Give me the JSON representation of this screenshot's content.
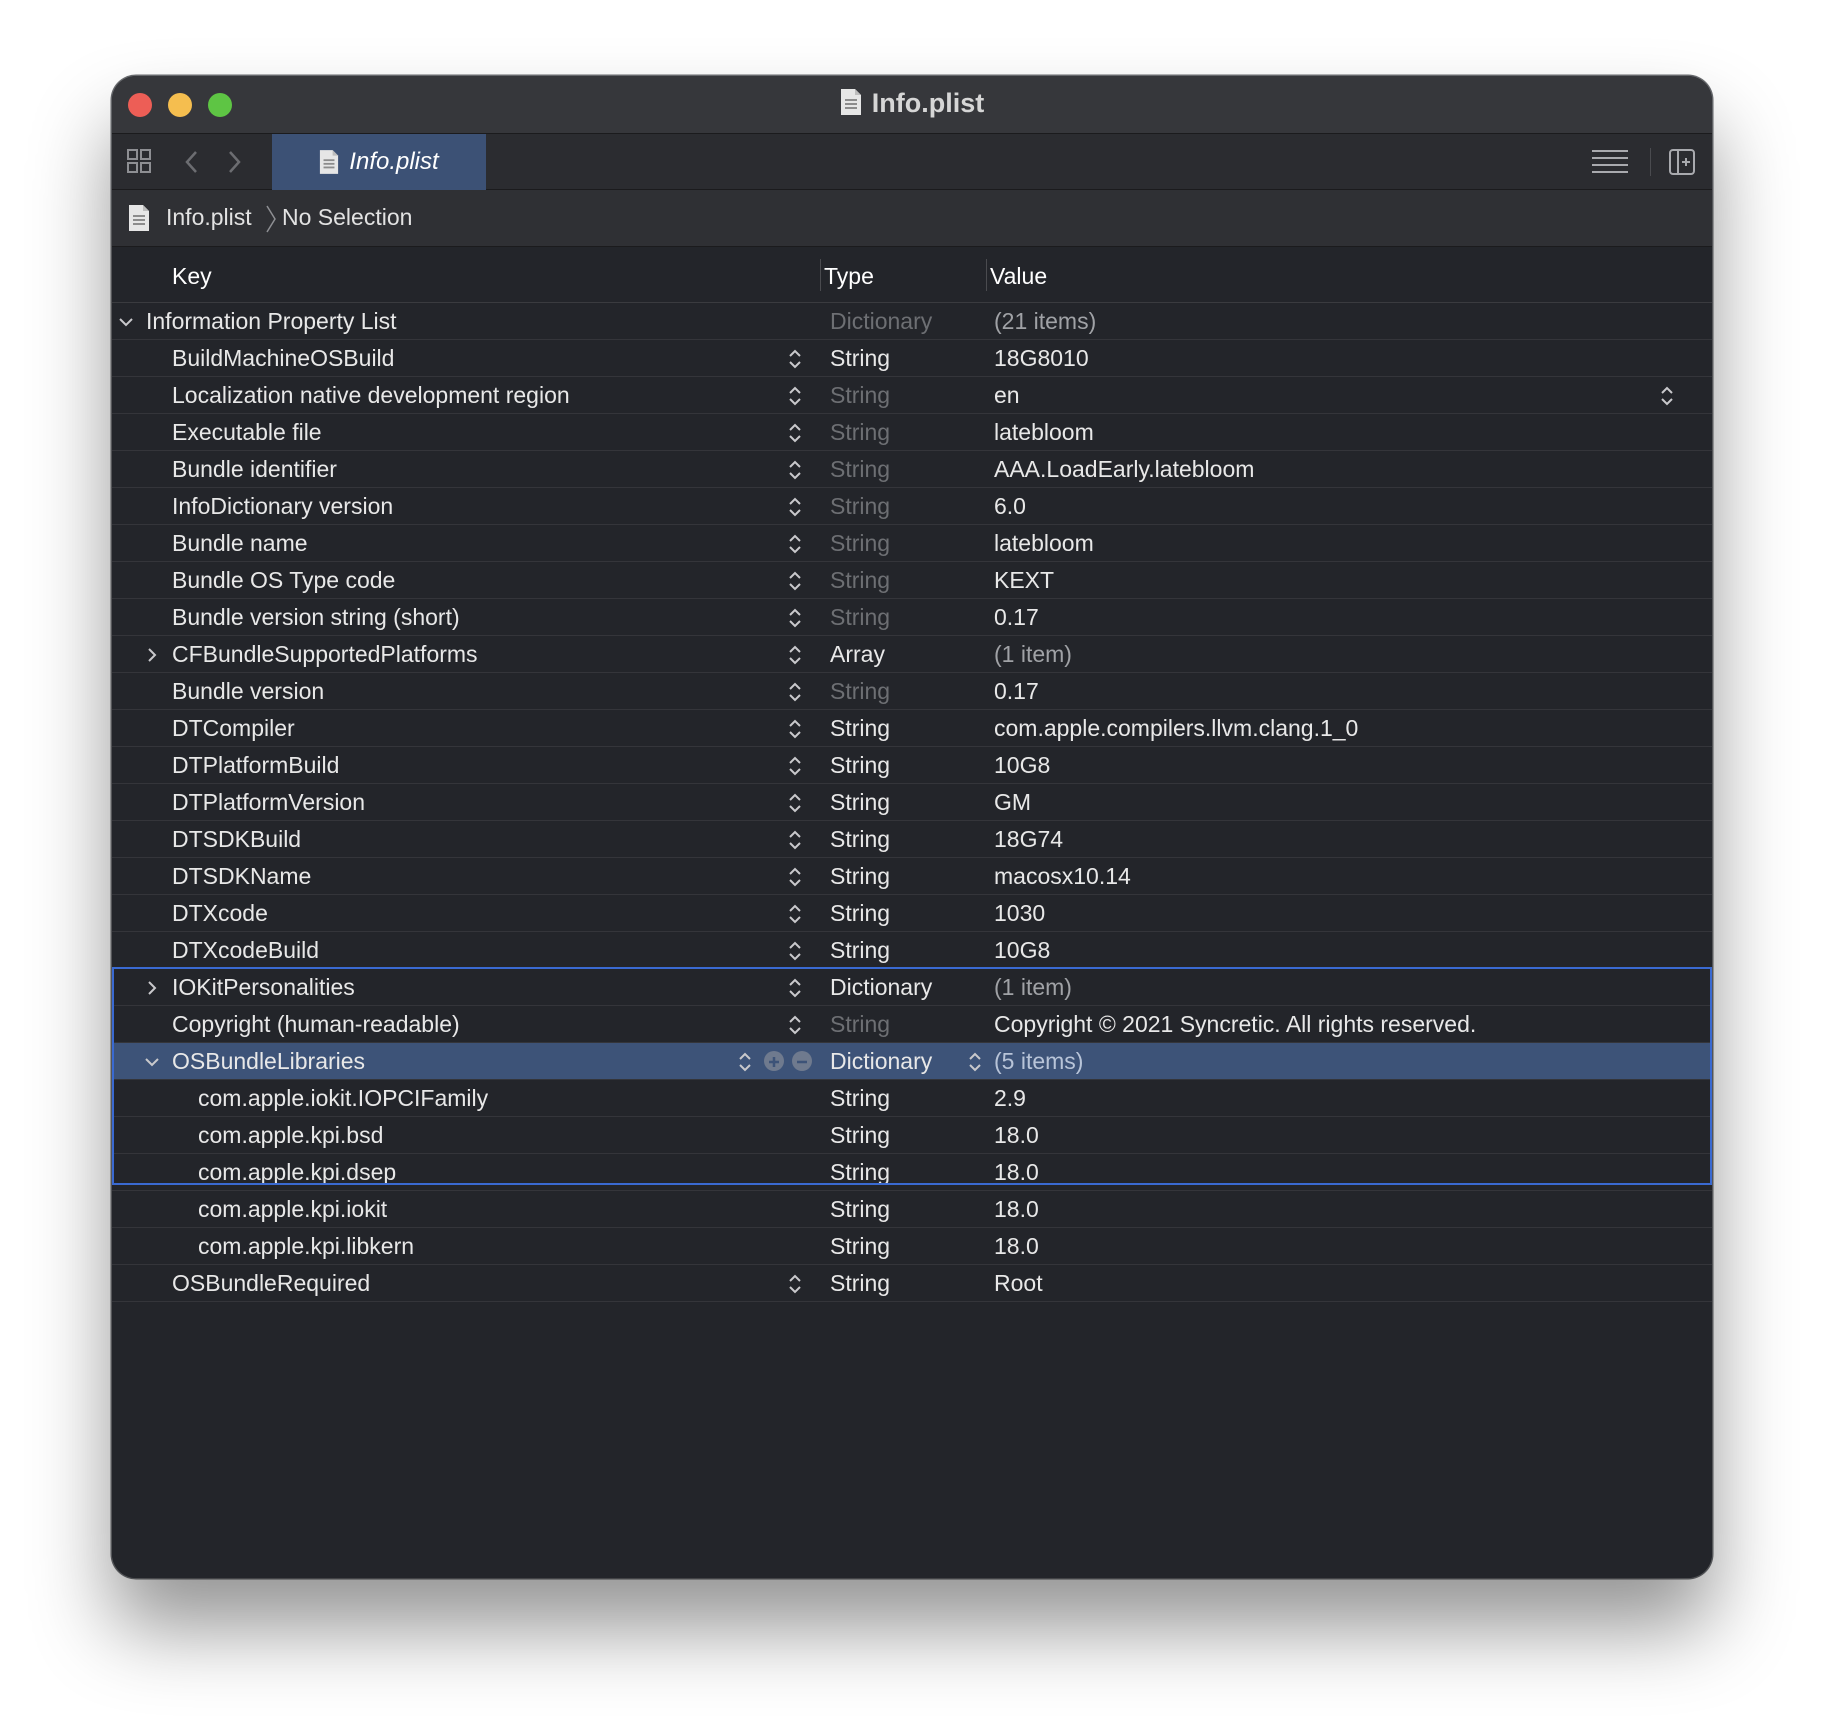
{
  "window": {
    "title": "Info.plist"
  },
  "tab": {
    "label": "Info.plist"
  },
  "jumpbar": {
    "file": "Info.plist",
    "selection": "No Selection"
  },
  "columns": {
    "key": "Key",
    "type": "Type",
    "value": "Value"
  },
  "rows": [
    {
      "key": "Information Property List",
      "type": "Dictionary",
      "value": "(21 items)"
    },
    {
      "key": "BuildMachineOSBuild",
      "type": "String",
      "value": "18G8010"
    },
    {
      "key": "Localization native development region",
      "type": "String",
      "value": "en"
    },
    {
      "key": "Executable file",
      "type": "String",
      "value": "latebloom"
    },
    {
      "key": "Bundle identifier",
      "type": "String",
      "value": "AAA.LoadEarly.latebloom"
    },
    {
      "key": "InfoDictionary version",
      "type": "String",
      "value": "6.0"
    },
    {
      "key": "Bundle name",
      "type": "String",
      "value": "latebloom"
    },
    {
      "key": "Bundle OS Type code",
      "type": "String",
      "value": "KEXT"
    },
    {
      "key": "Bundle version string (short)",
      "type": "String",
      "value": "0.17"
    },
    {
      "key": "CFBundleSupportedPlatforms",
      "type": "Array",
      "value": "(1 item)"
    },
    {
      "key": "Bundle version",
      "type": "String",
      "value": "0.17"
    },
    {
      "key": "DTCompiler",
      "type": "String",
      "value": "com.apple.compilers.llvm.clang.1_0"
    },
    {
      "key": "DTPlatformBuild",
      "type": "String",
      "value": "10G8"
    },
    {
      "key": "DTPlatformVersion",
      "type": "String",
      "value": "GM"
    },
    {
      "key": "DTSDKBuild",
      "type": "String",
      "value": "18G74"
    },
    {
      "key": "DTSDKName",
      "type": "String",
      "value": "macosx10.14"
    },
    {
      "key": "DTXcode",
      "type": "String",
      "value": "1030"
    },
    {
      "key": "DTXcodeBuild",
      "type": "String",
      "value": "10G8"
    },
    {
      "key": "IOKitPersonalities",
      "type": "Dictionary",
      "value": "(1 item)"
    },
    {
      "key": "Copyright (human-readable)",
      "type": "String",
      "value": "Copyright © 2021 Syncretic. All rights reserved."
    },
    {
      "key": "OSBundleLibraries",
      "type": "Dictionary",
      "value": "(5 items)"
    },
    {
      "key": "com.apple.iokit.IOPCIFamily",
      "type": "String",
      "value": "2.9"
    },
    {
      "key": "com.apple.kpi.bsd",
      "type": "String",
      "value": "18.0"
    },
    {
      "key": "com.apple.kpi.dsep",
      "type": "String",
      "value": "18.0"
    },
    {
      "key": "com.apple.kpi.iokit",
      "type": "String",
      "value": "18.0"
    },
    {
      "key": "com.apple.kpi.libkern",
      "type": "String",
      "value": "18.0"
    },
    {
      "key": "OSBundleRequired",
      "type": "String",
      "value": "Root"
    }
  ],
  "colors": {
    "selection": "#3d5378",
    "selection_border": "#3a6ad2",
    "active_tab": "#3c5175"
  }
}
